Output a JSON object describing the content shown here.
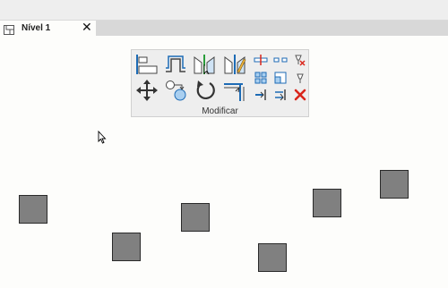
{
  "tab": {
    "title": "Nível 1",
    "close_glyph": "✕",
    "icon": "floor-plan-icon"
  },
  "ribbon_panel": {
    "label": "Modificar",
    "tools": [
      "align-icon",
      "offset-icon",
      "mirror-pick-axis-icon",
      "mirror-draw-axis-icon",
      "split-element-icon",
      "split-with-gap-icon",
      "unpin-icon",
      "move-icon",
      "copy-icon",
      "rotate-icon",
      "trim-extend-corner-icon",
      "array-icon",
      "scale-icon",
      "pin-icon",
      "trim-extend-single-icon",
      "trim-extend-multiple-icon",
      "delete-icon"
    ]
  },
  "canvas": {
    "elements": [
      "element-1",
      "element-2",
      "element-3",
      "element-4",
      "element-5",
      "element-6"
    ]
  },
  "colors": {
    "element_fill": "#808080",
    "delete_red": "#d9261c",
    "tool_blue": "#1d6bb5"
  }
}
